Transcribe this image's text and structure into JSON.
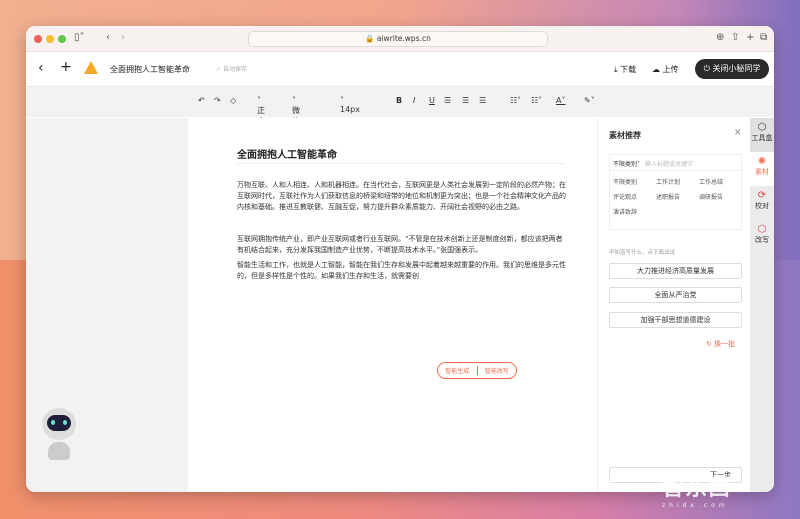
{
  "browser": {
    "url": "aiwrite.wps.cn"
  },
  "header": {
    "doc_title": "全面拥抱人工智能革命",
    "autosave": "自动保存",
    "download": "下载",
    "upload": "上传",
    "close_assistant": "关闭小秘同学"
  },
  "toolbar": {
    "style": "正文",
    "font": "微软雅...",
    "size": "14px"
  },
  "document": {
    "title": "全面拥抱人工智能革命",
    "paragraphs": [
      "万物互联、人和人相连、人和机器相连。在当代社会，互联网更是人类社会发展到一定阶段的必然产物；在互联网时代，互联社作为人们获取信息的桥梁和纽带的地位和机制更为突出；也是一个社会精神文化产品的内核和基础。推进互教联健、互融互促，努力提升群众素质能力、开阔社会视野的必由之路。",
      "互联网拥抱传统产业，即产业互联网或者行业互联网。“不管是在技术创新上还是制度创新，都应该把两者有机结合起来，充分发挥我国制造产业优势，不断提高技术水平。”张国强表示。",
      "智能生活和工作，也就是人工智能，智能在我们生存和发展中起着越来越重要的作用。我们的思维是多元性的，但是多样性是个性的。如果我们生存和生活，就需要创"
    ],
    "popup": {
      "generate": "智能生成",
      "rewrite": "智能改写"
    }
  },
  "panel": {
    "title": "素材推荐",
    "category": "不限类别",
    "search_placeholder": "输入标题或关键字",
    "categories": [
      "不限类别",
      "工作计划",
      "工作总结",
      "评论观点",
      "述职报告",
      "调研报告",
      "演讲致辞"
    ],
    "hint": "不知道写什么，点下面试试",
    "suggestions": [
      "大力推进经济高质量发展",
      "全面从严治党",
      "加强干部思想道德建设"
    ],
    "refresh": "换一批",
    "next": "下一步"
  },
  "rail": [
    {
      "label": "工具盒"
    },
    {
      "label": "素材"
    },
    {
      "label": "校对"
    },
    {
      "label": "改写"
    }
  ],
  "watermark": {
    "text": "智东西",
    "sub": "zhidx.com"
  },
  "colors": {
    "accent": "#f07050",
    "dark_button": "#2a2a2a"
  }
}
